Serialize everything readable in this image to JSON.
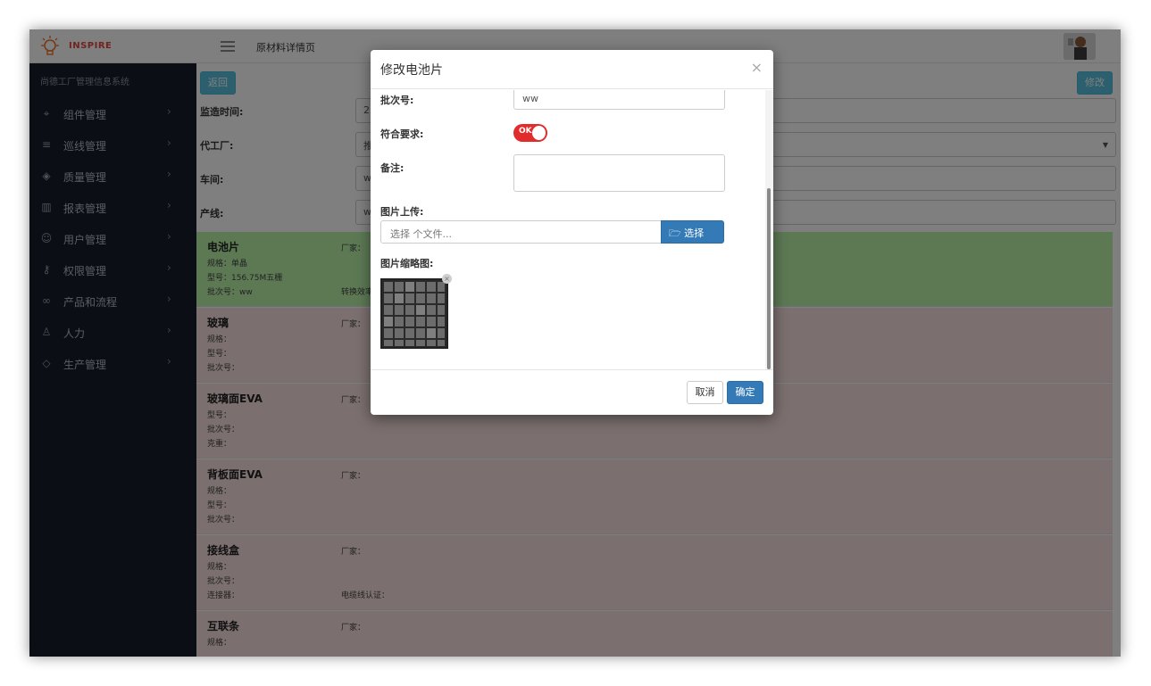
{
  "app": {
    "brand": "INSPIRE",
    "page_title": "原材料详情页",
    "system_name": "尚德工厂管理信息系统"
  },
  "sidebar": {
    "items": [
      {
        "label": "组件管理",
        "icon": "tag-icon"
      },
      {
        "label": "巡线管理",
        "icon": "list-icon"
      },
      {
        "label": "质量管理",
        "icon": "shield-icon"
      },
      {
        "label": "报表管理",
        "icon": "bar-chart-icon"
      },
      {
        "label": "用户管理",
        "icon": "users-icon"
      },
      {
        "label": "权限管理",
        "icon": "key-icon"
      },
      {
        "label": "产品和流程",
        "icon": "link-icon"
      },
      {
        "label": "人力",
        "icon": "user-icon"
      },
      {
        "label": "生产管理",
        "icon": "layers-icon"
      }
    ]
  },
  "content": {
    "back_label": "返回",
    "edit_label": "修改",
    "form": [
      {
        "label": "监造时间:",
        "value": "2"
      },
      {
        "label": "代工厂:",
        "value": "推"
      },
      {
        "label": "车间:",
        "value": "w"
      },
      {
        "label": "产线:",
        "value": "w"
      }
    ],
    "materials": [
      {
        "title": "电池片",
        "lines": [
          "规格：单晶",
          "型号：156.75M五栅",
          "批次号：ww"
        ],
        "vendor": "厂家：",
        "extra": "转换效率",
        "status": "green"
      },
      {
        "title": "玻璃",
        "lines": [
          "规格：",
          "型号：",
          "批次号："
        ],
        "vendor": "厂家：",
        "extra": "",
        "status": "pink"
      },
      {
        "title": "玻璃面EVA",
        "lines": [
          "型号：",
          "批次号：",
          "克重："
        ],
        "vendor": "厂家：",
        "extra": "",
        "status": "pink"
      },
      {
        "title": "背板面EVA",
        "lines": [
          "规格：",
          "型号：",
          "批次号："
        ],
        "vendor": "厂家：",
        "extra": "",
        "status": "pink"
      },
      {
        "title": "接线盒",
        "lines": [
          "规格：",
          "批次号：",
          "连接器："
        ],
        "vendor": "厂家：",
        "extra": "电缆线认证：",
        "status": "pink"
      },
      {
        "title": "互联条",
        "lines": [
          "规格：",
          "",
          ""
        ],
        "vendor": "厂家：",
        "extra": "",
        "status": "pink"
      }
    ]
  },
  "modal": {
    "title": "修改电池片",
    "close": "×",
    "batch_label": "批次号:",
    "batch_value": "ww",
    "meets_label": "符合要求:",
    "toggle_text": "OK",
    "toggle_on": true,
    "note_label": "备注:",
    "note_value": "",
    "upload_label": "图片上传:",
    "upload_placeholder": "选择 个文件...",
    "choose_label": "选择 …",
    "thumb_label": "图片缩略图:",
    "thumb_remove": "×",
    "cancel_label": "取消",
    "confirm_label": "确定"
  },
  "colors": {
    "sidebar_bg": "#161d2b",
    "green_row": "#b8f2a9",
    "pink_row": "#f6dede",
    "primary": "#337ab7",
    "info": "#5bc0de",
    "toggle_on": "#e22b2b"
  }
}
